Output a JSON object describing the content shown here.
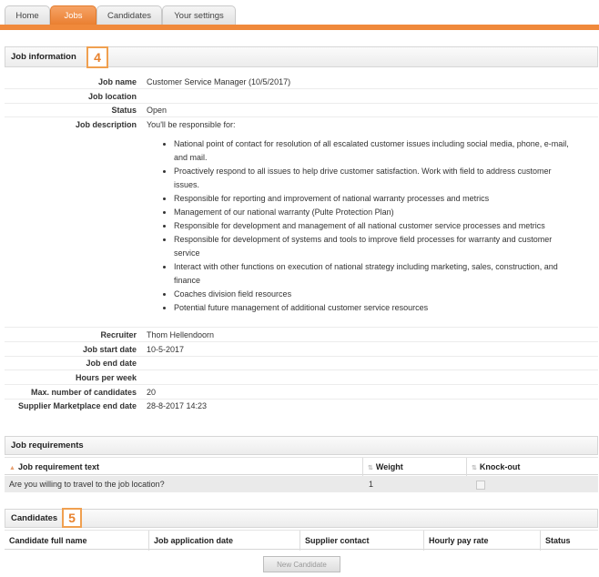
{
  "tabs": [
    {
      "label": "Home"
    },
    {
      "label": "Jobs"
    },
    {
      "label": "Candidates"
    },
    {
      "label": "Your settings"
    }
  ],
  "job_info": {
    "title": "Job information",
    "badge": "4",
    "job_name_label": "Job name",
    "job_name": "Customer Service Manager (10/5/2017)",
    "job_location_label": "Job location",
    "job_location": "",
    "status_label": "Status",
    "status": "Open",
    "job_description_label": "Job description",
    "description_intro": "You'll be responsible for:",
    "description_items": [
      "National point of contact for resolution of all escalated customer issues including social media, phone, e-mail, and mail.",
      "Proactively respond to all issues to help drive customer satisfaction.  Work with field to address customer issues.",
      "Responsible for reporting and improvement of national warranty processes and metrics",
      "Management of our national warranty (Pulte Protection Plan)",
      "Responsible for development and management of all national customer service processes and metrics",
      "Responsible for development of systems and tools to improve field processes for warranty and customer service",
      "Interact with other functions on execution of national strategy including marketing, sales, construction, and finance",
      "Coaches division field resources",
      "Potential future management of additional customer service resources"
    ],
    "recruiter_label": "Recruiter",
    "recruiter": "Thom Hellendoorn",
    "start_date_label": "Job start date",
    "start_date": "10-5-2017",
    "end_date_label": "Job end date",
    "end_date": "",
    "hours_label": "Hours per week",
    "hours": "",
    "max_candidates_label": "Max. number of candidates",
    "max_candidates": "20",
    "marketplace_end_label": "Supplier Marketplace end date",
    "marketplace_end": "28-8-2017 14:23"
  },
  "requirements": {
    "title": "Job requirements",
    "columns": [
      "Job requirement text",
      "Weight",
      "Knock-out"
    ],
    "rows": [
      {
        "text": "Are you willing to travel to the job location?",
        "weight": "1",
        "knockout": false
      }
    ]
  },
  "candidates": {
    "title": "Candidates",
    "badge": "5",
    "columns": [
      "Candidate full name",
      "Job application date",
      "Supplier contact",
      "Hourly pay rate",
      "Status"
    ],
    "new_button": "New Candidate"
  },
  "colors": {
    "accent": "#f0893b",
    "badge_border": "#f0a050"
  }
}
